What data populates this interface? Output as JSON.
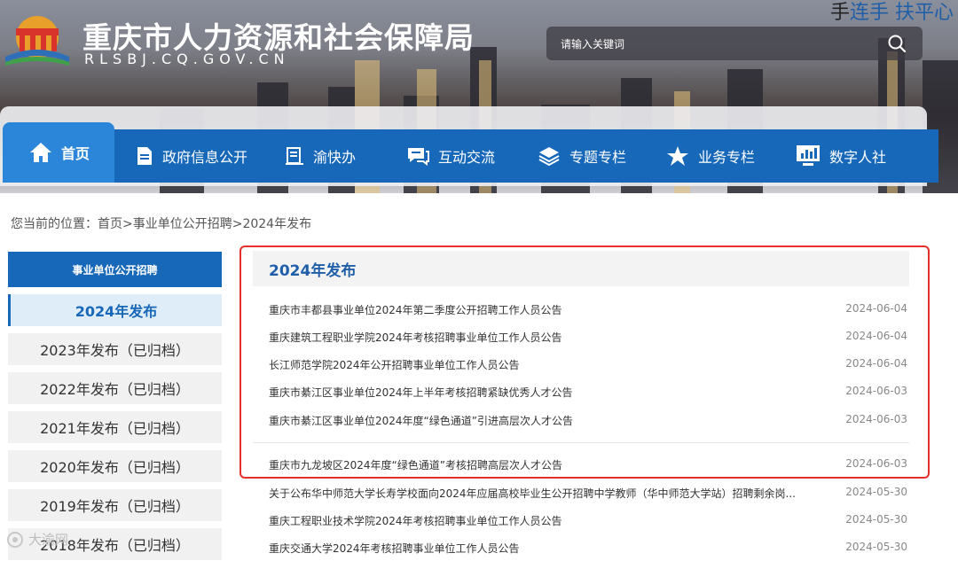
{
  "header": {
    "site_title": "重庆市人力资源和社会保障局",
    "site_domain": "RLSBJ.CQ.GOV.CN",
    "slogan_prefix": "手",
    "slogan_highlight": "连手  扶平心"
  },
  "search": {
    "placeholder": "请输入关键词",
    "value": ""
  },
  "nav": {
    "items": [
      {
        "label": "首页",
        "icon": "home-icon"
      },
      {
        "label": "政府信息公开",
        "icon": "document-icon"
      },
      {
        "label": "渝快办",
        "icon": "clipboard-icon"
      },
      {
        "label": "互动交流",
        "icon": "chat-icon"
      },
      {
        "label": "专题专栏",
        "icon": "layers-icon"
      },
      {
        "label": "业务专栏",
        "icon": "star-icon"
      },
      {
        "label": "数字人社",
        "icon": "monitor-chart-icon"
      }
    ]
  },
  "breadcrumb": "您当前的位置：首页>事业单位公开招聘>2024年发布",
  "sidebar": {
    "heading": "事业单位公开招聘",
    "items": [
      {
        "label": "2024年发布"
      },
      {
        "label": "2023年发布（已归档）"
      },
      {
        "label": "2022年发布（已归档）"
      },
      {
        "label": "2021年发布（已归档）"
      },
      {
        "label": "2020年发布（已归档）"
      },
      {
        "label": "2019年发布（已归档）"
      },
      {
        "label": "2018年发布（已归档）"
      }
    ]
  },
  "main": {
    "title": "2024年发布",
    "articles": [
      {
        "title": "重庆市丰都县事业单位2024年第二季度公开招聘工作人员公告",
        "date": "2024-06-04"
      },
      {
        "title": "重庆建筑工程职业学院2024年考核招聘事业单位工作人员公告",
        "date": "2024-06-04"
      },
      {
        "title": "长江师范学院2024年公开招聘事业单位工作人员公告",
        "date": "2024-06-04"
      },
      {
        "title": "重庆市綦江区事业单位2024年上半年考核招聘紧缺优秀人才公告",
        "date": "2024-06-03"
      },
      {
        "title": "重庆市綦江区事业单位2024年度“绿色通道”引进高层次人才公告",
        "date": "2024-06-03"
      },
      {
        "title": "重庆市九龙坡区2024年度“绿色通道”考核招聘高层次人才公告",
        "date": "2024-06-03"
      },
      {
        "title": "关于公布华中师范大学长寿学校面向2024年应届高校毕业生公开招聘中学教师（华中师范大学站）招聘剩余岗...",
        "date": "2024-05-30"
      },
      {
        "title": "重庆工程职业技术学院2024年考核招聘事业单位工作人员公告",
        "date": "2024-05-30"
      },
      {
        "title": "重庆交通大学2024年考核招聘事业单位工作人员公告",
        "date": "2024-05-30"
      }
    ]
  },
  "watermark": "大渝网",
  "colors": {
    "nav_blue": "#1768b8",
    "nav_active": "#2b85d9",
    "title_blue": "#1f5ea8",
    "highlight_red": "#e5302a"
  }
}
